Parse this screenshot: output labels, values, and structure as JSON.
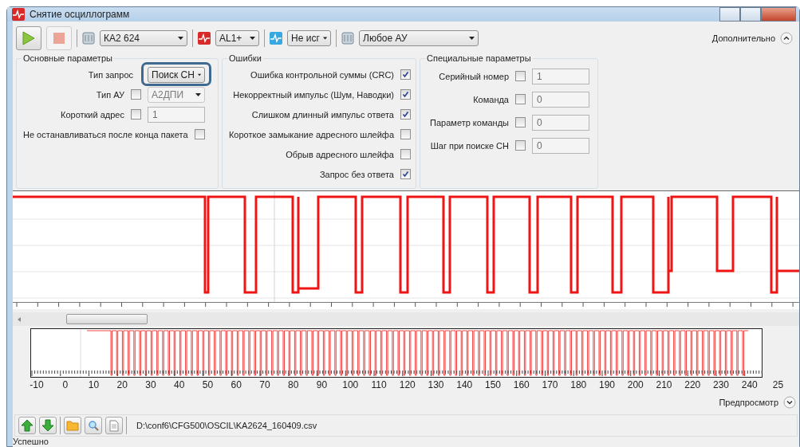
{
  "window": {
    "title": "Снятие осциллограмм"
  },
  "toolbar": {
    "combos": [
      {
        "kind": "device",
        "value": "КА2 624"
      },
      {
        "kind": "signal",
        "value": "AL1+"
      },
      {
        "kind": "wave",
        "value": "Не исг"
      },
      {
        "kind": "device",
        "value": "Любое АУ"
      }
    ],
    "more": "Дополнительно"
  },
  "basic": {
    "title": "Основные параметры",
    "request_type": {
      "label": "Тип запрос",
      "value": "Поиск СН"
    },
    "au_type": {
      "label": "Тип АУ",
      "checked": false,
      "value": "А2ДПИ"
    },
    "short_address": {
      "label": "Короткий адрес",
      "checked": false,
      "value": "1"
    },
    "no_stop": {
      "label": "Не останавливаться после конца пакета",
      "checked": false
    }
  },
  "errors": {
    "title": "Ошибки",
    "items": [
      {
        "label": "Ошибка контрольной суммы (CRC)",
        "checked": true
      },
      {
        "label": "Некорректный импульс (Шум, Наводки)",
        "checked": true
      },
      {
        "label": "Слишком длинный импульс ответа",
        "checked": true
      },
      {
        "label": "Короткое замыкание адресного шлейфа",
        "checked": false
      },
      {
        "label": "Обрыв адресного шлейфа",
        "checked": false
      },
      {
        "label": "Запрос без ответа",
        "checked": true
      }
    ]
  },
  "special": {
    "title": "Специальные параметры",
    "items": [
      {
        "label": "Серийный номер",
        "checked": false,
        "value": "1"
      },
      {
        "label": "Команда",
        "checked": false,
        "value": "0"
      },
      {
        "label": "Параметр команды",
        "checked": false,
        "value": "0"
      },
      {
        "label": "Шаг при поиске СН",
        "checked": false,
        "value": "0"
      }
    ]
  },
  "preview": {
    "axis_labels": [
      "-10",
      "0",
      "10",
      "20",
      "30",
      "40",
      "50",
      "60",
      "70",
      "80",
      "90",
      "100",
      "110",
      "120",
      "130",
      "140",
      "150",
      "160",
      "170",
      "180",
      "190",
      "200",
      "210",
      "220",
      "230",
      "240",
      "25"
    ],
    "label": "Предпросмотр"
  },
  "file_path": "D:\\conf6\\CFG500\\OSCIL\\KA2624_160409.csv",
  "status": "Успешно"
}
